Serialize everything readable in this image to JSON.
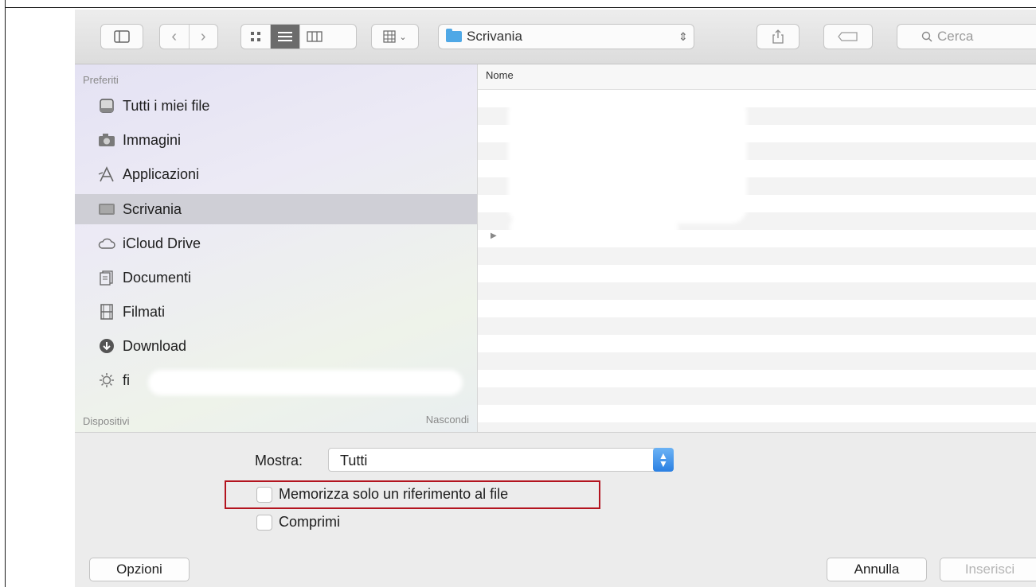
{
  "toolbar": {
    "path_label": "Scrivania",
    "search_placeholder": "Cerca"
  },
  "sidebar": {
    "favorites_header": "Preferiti",
    "items": [
      {
        "label": "Tutti i miei file",
        "icon": "all-files-icon"
      },
      {
        "label": "Immagini",
        "icon": "camera-icon"
      },
      {
        "label": "Applicazioni",
        "icon": "applications-icon"
      },
      {
        "label": "Scrivania",
        "icon": "desktop-icon",
        "selected": true
      },
      {
        "label": "iCloud Drive",
        "icon": "cloud-icon"
      },
      {
        "label": "Documenti",
        "icon": "document-icon"
      },
      {
        "label": "Filmati",
        "icon": "film-icon"
      },
      {
        "label": "Download",
        "icon": "download-icon"
      },
      {
        "label": "fi",
        "icon": "gear-icon"
      }
    ],
    "devices_header": "Dispositivi",
    "hide_label": "Nascondi"
  },
  "file_list": {
    "column_name": "Nome"
  },
  "options": {
    "show_label": "Mostra:",
    "show_value": "Tutti",
    "checkbox_reference": "Memorizza solo un riferimento al file",
    "checkbox_compress": "Comprimi"
  },
  "buttons": {
    "options": "Opzioni",
    "cancel": "Annulla",
    "insert": "Inserisci"
  },
  "colors": {
    "highlight": "#b3141f",
    "accent": "#2a7fe2",
    "folder": "#4fa8e6"
  }
}
